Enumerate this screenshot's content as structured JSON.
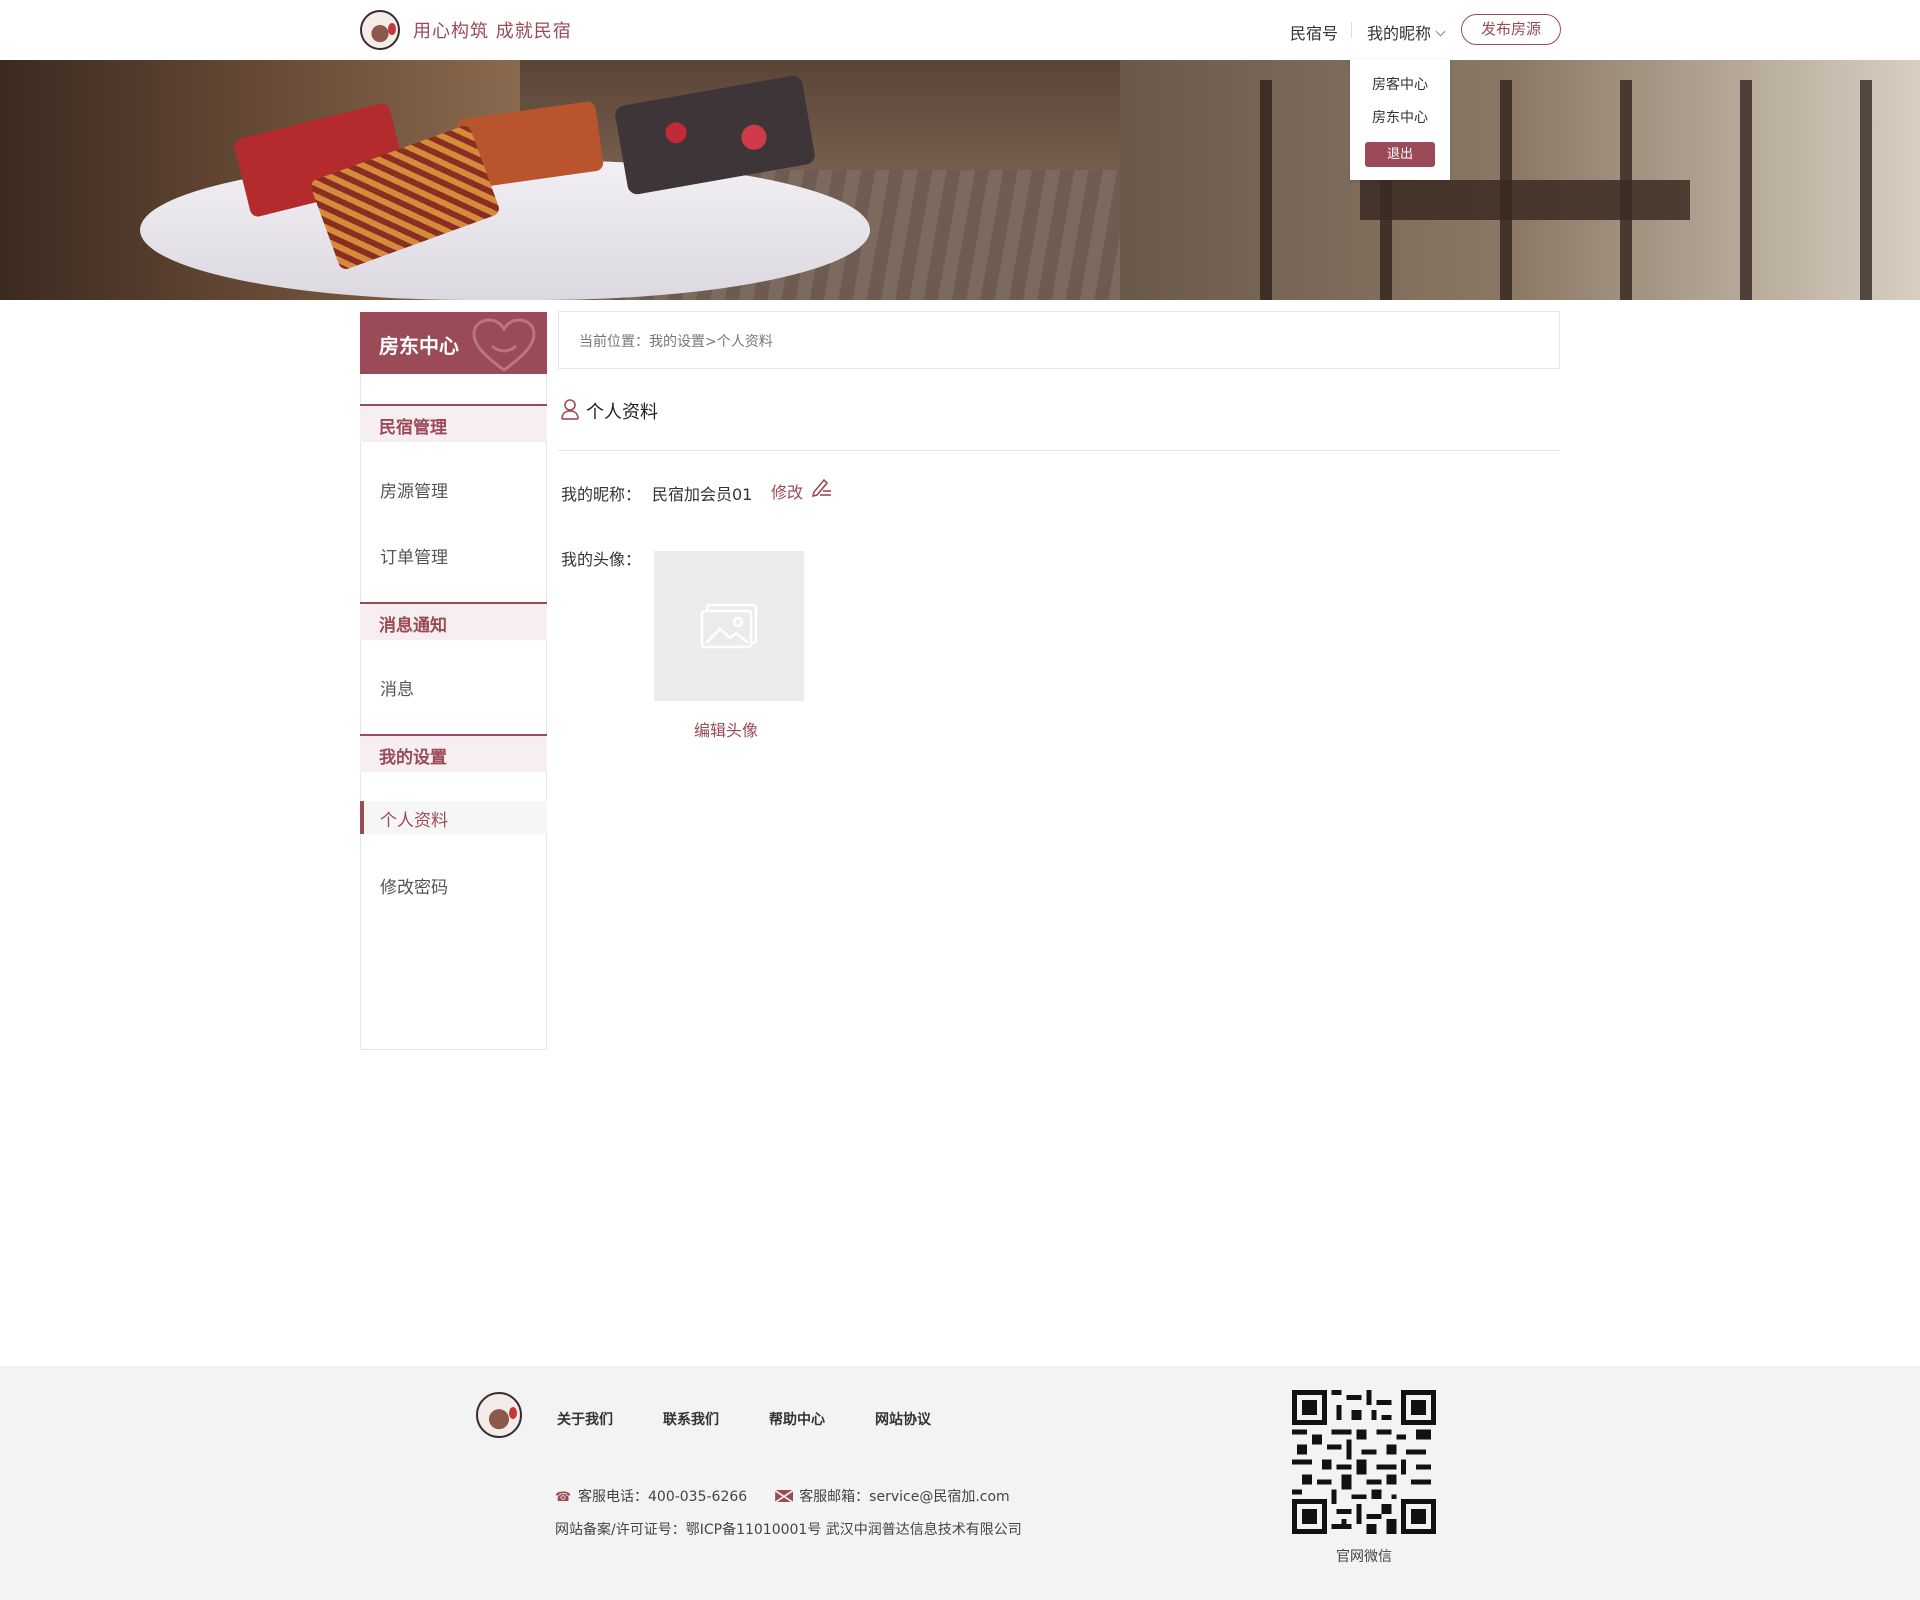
{
  "header": {
    "slogan": "用心构筑  成就民宿",
    "nav_minsu": "民宿号",
    "nav_nickname": "我的昵称",
    "publish_button": "发布房源"
  },
  "dropdown": {
    "guest_center": "房客中心",
    "host_center": "房东中心",
    "logout": "退出"
  },
  "sidebar": {
    "title": "房东中心",
    "groups": [
      {
        "label": "民宿管理",
        "items": [
          "房源管理",
          "订单管理"
        ]
      },
      {
        "label": "消息通知",
        "items": [
          "消息"
        ]
      },
      {
        "label": "我的设置",
        "items": [
          "个人资料",
          "修改密码"
        ]
      }
    ],
    "active_item": "个人资料"
  },
  "main": {
    "breadcrumb": "当前位置：我的设置>个人资料",
    "section_title": "个人资料",
    "nickname_label": "我的昵称：",
    "nickname_value": "民宿加会员01",
    "edit_label": "修改",
    "avatar_label": "我的头像：",
    "edit_avatar": "编辑头像"
  },
  "footer": {
    "links": [
      "关于我们",
      "联系我们",
      "帮助中心",
      "网站协议"
    ],
    "phone": "客服电话：400-035-6266",
    "email": "客服邮箱：service@民宿加.com",
    "icp": "网站备案/许可证号：鄂ICP备11010001号  武汉中润普达信息技术有限公司",
    "qr_label": "官网微信"
  },
  "colors": {
    "accent": "#9a4b57",
    "accent_light": "#f6eef0",
    "footer_bg": "#f3f3f3"
  }
}
